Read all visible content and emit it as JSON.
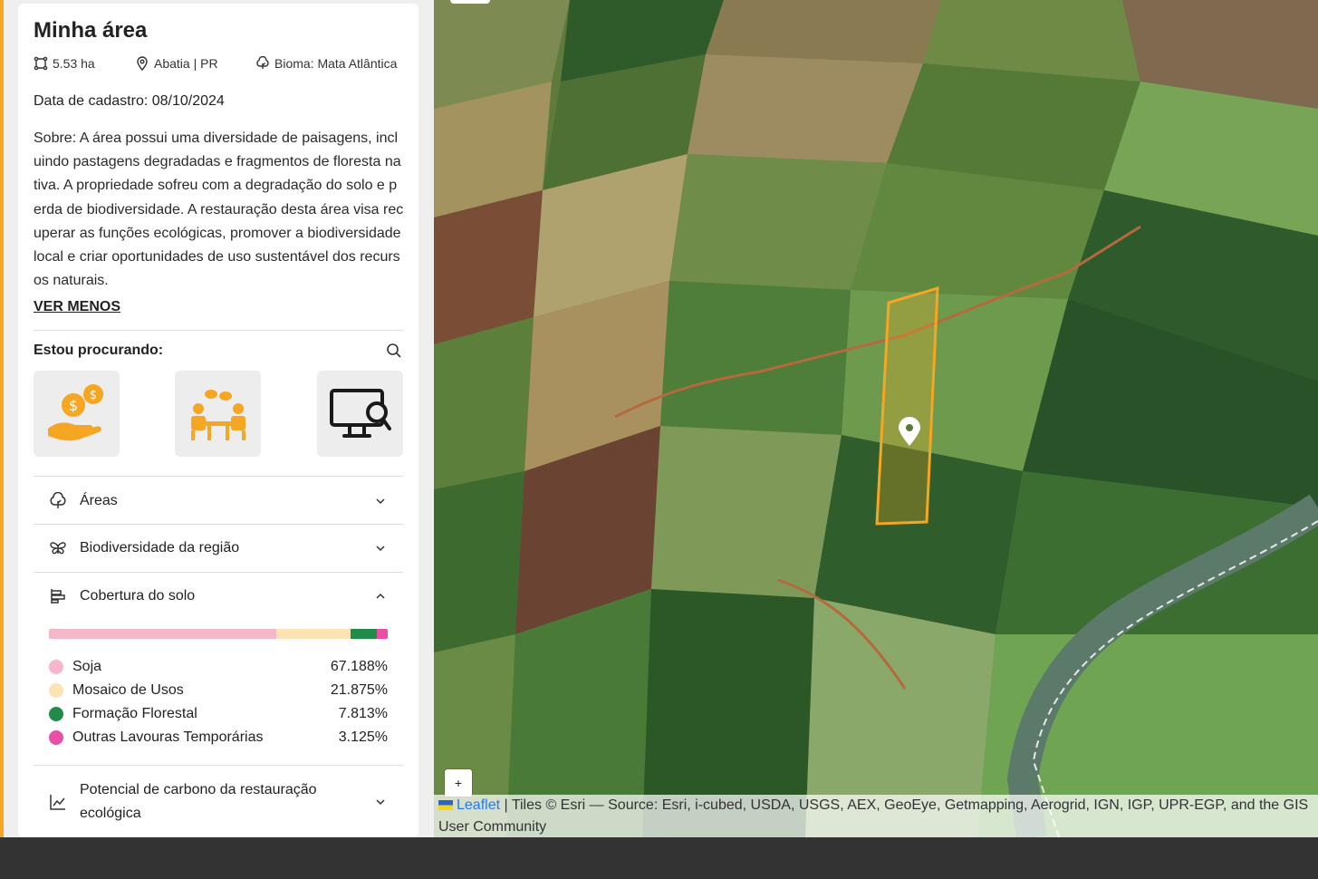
{
  "area": {
    "title": "Minha área",
    "size": "5.53 ha",
    "location": "Abatia | PR",
    "biome": "Bioma: Mata Atlântica",
    "registration_date": "Data de cadastro: 08/10/2024",
    "about": "Sobre: A área possui uma diversidade de paisagens, incluindo pastagens degradadas e fragmentos de floresta nativa. A propriedade sofreu com a degradação do solo e perda de biodiversidade. A restauração desta área visa recuperar as funções ecológicas, promover a biodiversidade local e criar oportunidades de uso sustentável dos recursos naturais.",
    "toggle_label": "VER MENOS"
  },
  "seeking": {
    "label": "Estou procurando:",
    "search_icon": "search-icon",
    "tiles": [
      {
        "icon": "money-hand-icon"
      },
      {
        "icon": "meeting-people-icon"
      },
      {
        "icon": "monitor-search-icon"
      }
    ]
  },
  "accordions": {
    "areas": {
      "label": "Áreas",
      "icon": "tree-icon",
      "expanded": false
    },
    "biodiversity": {
      "label": "Biodiversidade da região",
      "icon": "butterfly-icon",
      "expanded": false
    },
    "land_cover": {
      "label": "Cobertura do solo",
      "icon": "bars-icon",
      "expanded": true
    },
    "carbon": {
      "label": "Potencial de carbono da restauração ecológica",
      "icon": "chart-line-icon",
      "expanded": false
    }
  },
  "land_cover": {
    "items": [
      {
        "name": "Soja",
        "value": "67.188%",
        "fraction": 0.67188,
        "color": "#f4b8c9"
      },
      {
        "name": "Mosaico de Usos",
        "value": "21.875%",
        "fraction": 0.21875,
        "color": "#fbe3b3"
      },
      {
        "name": "Formação Florestal",
        "value": "7.813%",
        "fraction": 0.07813,
        "color": "#1f8d49"
      },
      {
        "name": "Outras Lavouras Temporárias",
        "value": "3.125%",
        "fraction": 0.03125,
        "color": "#ea4fa8"
      }
    ]
  },
  "map": {
    "zoom_in_label": "+",
    "attribution": {
      "link": "Leaflet",
      "text": "| Tiles © Esri — Source: Esri, i-cubed, USDA, USGS, AEX, GeoEye, Getmapping, Aerogrid, IGN, IGP, UPR-EGP, and the GIS User Community"
    },
    "polygon_color": "#f5a623",
    "marker_icon": "map-pin-icon"
  },
  "colors": {
    "accent": "#f5a623",
    "footer": "#333333"
  }
}
